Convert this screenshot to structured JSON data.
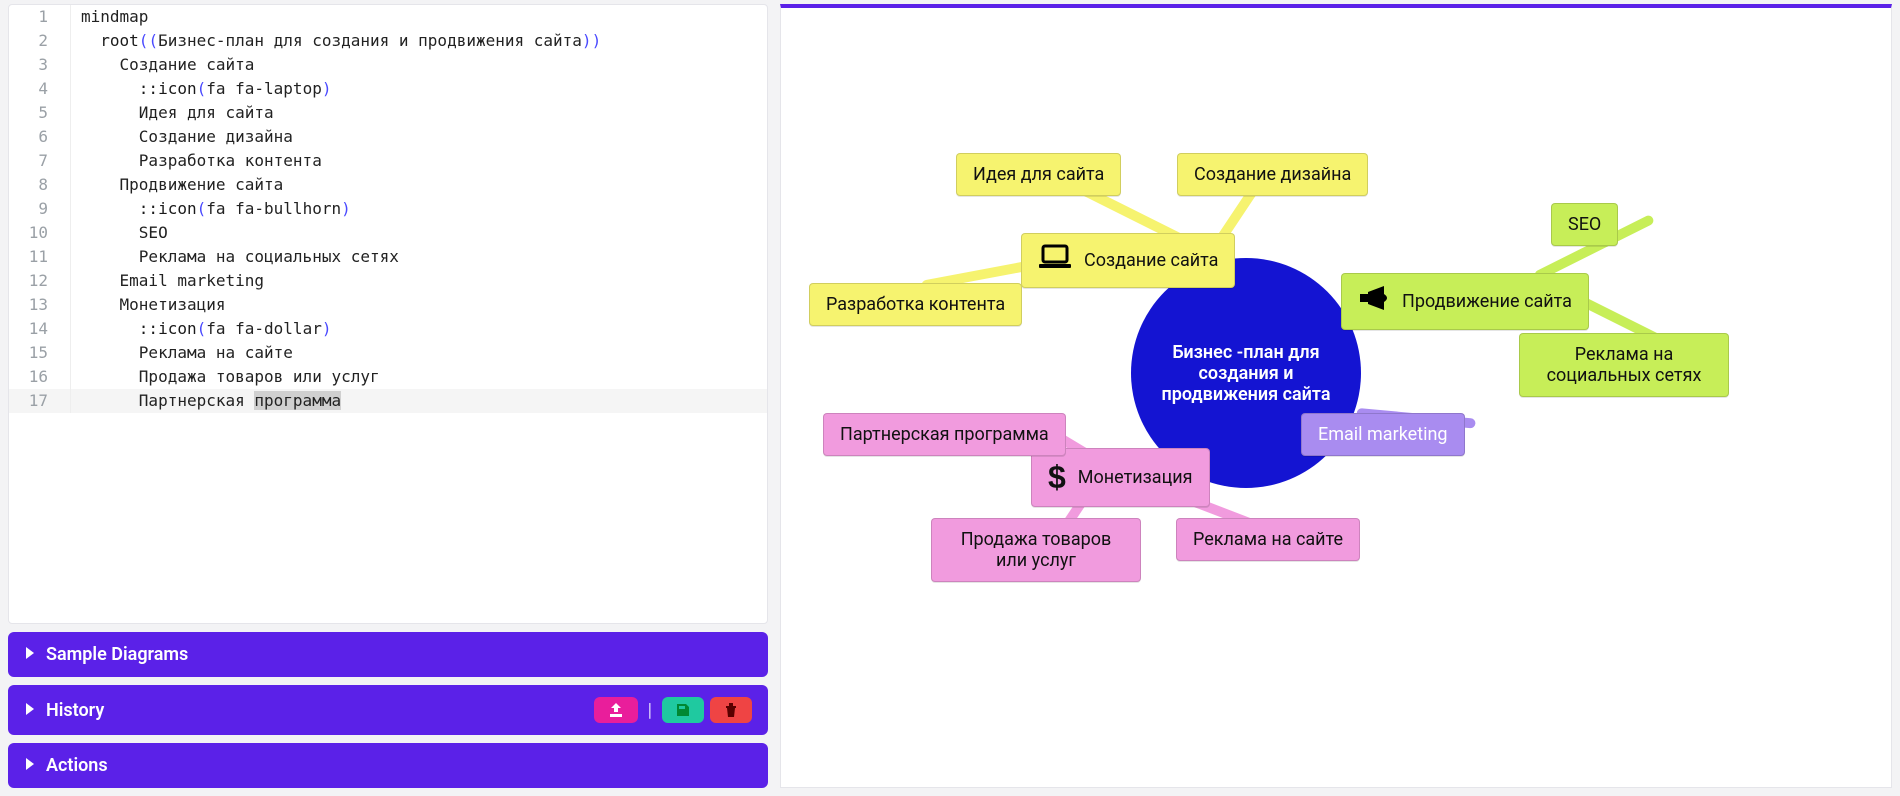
{
  "editor": {
    "lines": [
      "mindmap",
      "  root((Бизнес-план для создания и продвижения сайта))",
      "    Создание сайта",
      "      ::icon(fa fa-laptop)",
      "      Идея для сайта",
      "      Создание дизайна",
      "      Разработка контента",
      "    Продвижение сайта",
      "      ::icon(fa fa-bullhorn)",
      "      SEO",
      "      Реклама на социальных сетях",
      "    Email marketing",
      "    Монетизация",
      "      ::icon(fa fa-dollar)",
      "      Реклама на сайте",
      "      Продажа товаров или услуг",
      "      Партнерская программа"
    ],
    "tokens": {
      "root_keyword": "root",
      "icon_keyword": "::icon"
    },
    "active_line_index": 16,
    "selection_word": "программа"
  },
  "sections": {
    "sample": "Sample Diagrams",
    "history": "History",
    "actions": "Actions"
  },
  "mindmap": {
    "root": "Бизнес -план для создания и продвижения сайта",
    "branches": {
      "create": {
        "label": "Создание сайта",
        "icon": "laptop",
        "children": [
          "Идея для сайта",
          "Создание дизайна",
          "Разработка контента"
        ]
      },
      "promote": {
        "label": "Продвижение сайта",
        "icon": "bullhorn",
        "children": [
          "SEO",
          "Реклама на социальных сетях"
        ]
      },
      "email": {
        "label": "Email marketing"
      },
      "monetize": {
        "label": "Монетизация",
        "icon": "dollar",
        "children": [
          "Реклама на сайте",
          "Продажа товаров или услуг",
          "Партнерская программа"
        ]
      }
    }
  },
  "colors": {
    "accent": "#5b21e8",
    "root_circle": "#1414d2",
    "yellow": "#f6f36f",
    "green": "#c7ee58",
    "purple": "#a98cf0",
    "pink": "#f19bde"
  }
}
